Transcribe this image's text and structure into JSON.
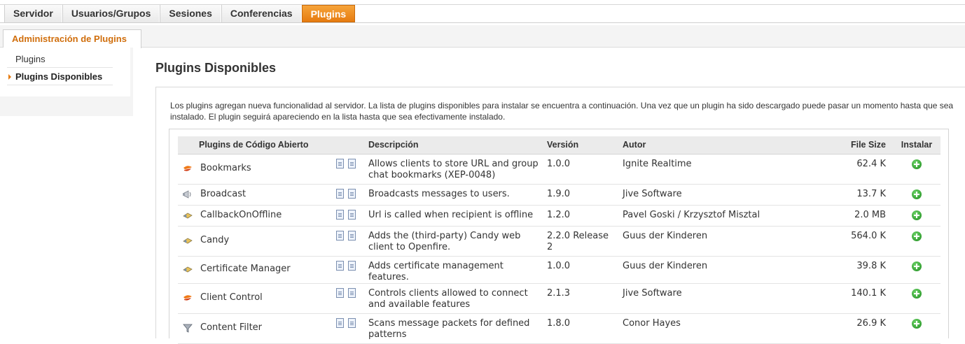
{
  "top_tabs": [
    {
      "label": "Servidor"
    },
    {
      "label": "Usuarios/Grupos"
    },
    {
      "label": "Sesiones"
    },
    {
      "label": "Conferencias"
    },
    {
      "label": "Plugins",
      "active": true
    }
  ],
  "sub_tab": {
    "label": "Administración de Plugins"
  },
  "sidebar": {
    "items": [
      {
        "label": "Plugins"
      },
      {
        "label": "Plugins Disponibles",
        "selected": true
      }
    ]
  },
  "page_title": "Plugins Disponibles",
  "intro_text": "Los plugins agregan nueva funcionalidad al servidor. La lista de plugins disponibles para instalar se encuentra a continuación. Una vez que un plugin ha sido descargado puede pasar un momento hasta que sea instalado. El plugin seguirá apareciendo en la lista hasta que sea efectivamente instalado.",
  "table": {
    "headers": {
      "name": "Plugins de Código Abierto",
      "description": "Descripción",
      "version": "Versión",
      "author": "Autor",
      "size": "File Size",
      "install": "Instalar"
    },
    "rows": [
      {
        "icon": "bookmark-icon",
        "name": "Bookmarks",
        "description": "Allows clients to store URL and group chat bookmarks (XEP-0048)",
        "version": "1.0.0",
        "author": "Ignite Realtime",
        "size": "62.4 K"
      },
      {
        "icon": "broadcast-icon",
        "name": "Broadcast",
        "description": "Broadcasts messages to users.",
        "version": "1.9.0",
        "author": "Jive Software",
        "size": "13.7 K"
      },
      {
        "icon": "plugin-icon",
        "name": "CallbackOnOffline",
        "description": "Url is called when recipient is offline",
        "version": "1.2.0",
        "author": "Pavel Goski / Krzysztof Misztal",
        "size": "2.0 MB"
      },
      {
        "icon": "plugin-icon",
        "name": "Candy",
        "description": "Adds the (third-party) Candy web client to Openfire.",
        "version": "2.2.0 Release 2",
        "author": "Guus der Kinderen",
        "size": "564.0 K"
      },
      {
        "icon": "plugin-icon",
        "name": "Certificate Manager",
        "description": "Adds certificate management features.",
        "version": "1.0.0",
        "author": "Guus der Kinderen",
        "size": "39.8 K"
      },
      {
        "icon": "bookmark-icon",
        "name": "Client Control",
        "description": "Controls clients allowed to connect and available features",
        "version": "2.1.3",
        "author": "Jive Software",
        "size": "140.1 K"
      },
      {
        "icon": "filter-icon",
        "name": "Content Filter",
        "description": "Scans message packets for defined patterns",
        "version": "1.8.0",
        "author": "Conor Hayes",
        "size": "26.9 K"
      }
    ]
  },
  "colors": {
    "accent": "#e67b10",
    "install_green": "#1d8a1d"
  }
}
